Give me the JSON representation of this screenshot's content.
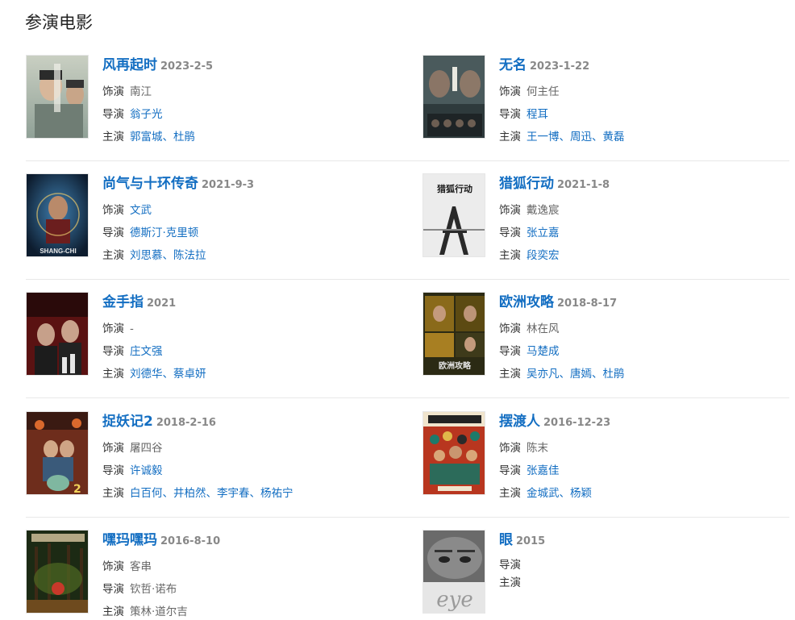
{
  "section": {
    "title": "参演电影"
  },
  "labels": {
    "role": "饰演",
    "director": "导演",
    "cast": "主演"
  },
  "accent": "#136ec2",
  "movies": [
    {
      "title": "风再起时",
      "date": "2023-2-5",
      "role": "南江",
      "director": [
        "翁子光"
      ],
      "cast": [
        "郭富城",
        "杜鹃"
      ]
    },
    {
      "title": "无名",
      "date": "2023-1-22",
      "role": "何主任",
      "director": [
        "程耳"
      ],
      "cast": [
        "王一博",
        "周迅",
        "黄磊"
      ]
    },
    {
      "title": "尚气与十环传奇",
      "date": "2021-9-3",
      "role": "文武",
      "director": [
        "德斯汀·克里顿"
      ],
      "cast": [
        "刘思慕",
        "陈法拉"
      ]
    },
    {
      "title": "猎狐行动",
      "date": "2021-1-8",
      "role": "戴逸宸",
      "director": [
        "张立嘉"
      ],
      "cast": [
        "段奕宏"
      ]
    },
    {
      "title": "金手指",
      "date": "2021",
      "role": "-",
      "director": [
        "庄文强"
      ],
      "cast": [
        "刘德华",
        "蔡卓妍"
      ]
    },
    {
      "title": "欧洲攻略",
      "date": "2018-8-17",
      "role": "林在风",
      "director": [
        "马楚成"
      ],
      "cast": [
        "吴亦凡",
        "唐嫣",
        "杜鹃"
      ]
    },
    {
      "title": "捉妖记2",
      "date": "2018-2-16",
      "role": "屠四谷",
      "director": [
        "许诚毅"
      ],
      "cast": [
        "白百何",
        "井柏然",
        "李宇春",
        "杨祐宁"
      ]
    },
    {
      "title": "摆渡人",
      "date": "2016-12-23",
      "role": "陈末",
      "director": [
        "张嘉佳"
      ],
      "cast": [
        "金城武",
        "杨颖"
      ]
    },
    {
      "title": "嘿玛嘿玛",
      "date": "2016-8-10",
      "role": "客串",
      "director": [
        "钦哲·诺布"
      ],
      "cast": [
        "策林·道尔吉"
      ]
    },
    {
      "title": "眼",
      "date": "2015",
      "role": "",
      "director": [],
      "cast": []
    }
  ],
  "poster_text": {
    "shang_chi": "SHANG-CHI",
    "eye": "eye",
    "europe": "欧洲攻略",
    "fox": "猎狐行动"
  }
}
